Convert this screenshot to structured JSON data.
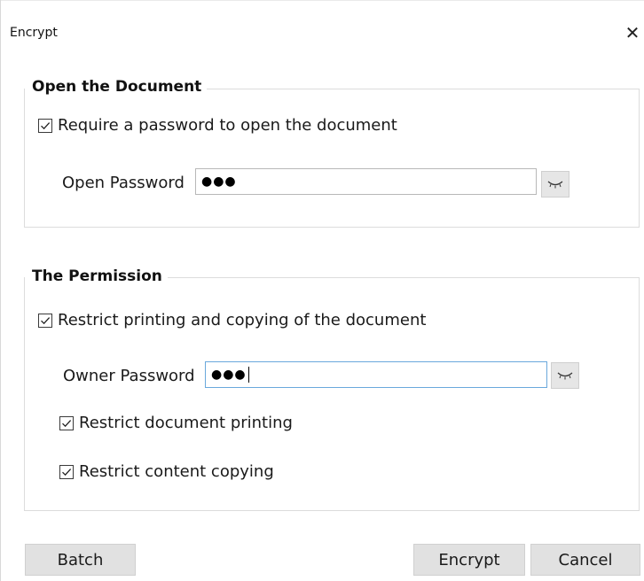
{
  "window": {
    "title": "Encrypt",
    "close_glyph": "✕"
  },
  "open_section": {
    "legend": "Open the Document",
    "require_checkbox": {
      "label": "Require a password to open the document",
      "checked": true
    },
    "password": {
      "label": "Open Password",
      "value_masked": "●●●"
    },
    "reveal_icon": "closed-eye-icon"
  },
  "permission_section": {
    "legend": "The Permission",
    "restrict_checkbox": {
      "label": "Restrict printing and copying of the document",
      "checked": true
    },
    "password": {
      "label": "Owner Password",
      "value_masked": "●●●"
    },
    "reveal_icon": "closed-eye-icon",
    "options": [
      {
        "label": "Restrict document printing",
        "checked": true
      },
      {
        "label": "Restrict content copying",
        "checked": true
      }
    ]
  },
  "buttons": {
    "batch": "Batch",
    "encrypt": "Encrypt",
    "cancel": "Cancel"
  },
  "colors": {
    "focus_border": "#6aa8dc",
    "button_bg": "#e1e1e1",
    "group_border": "#dcdcdc"
  }
}
